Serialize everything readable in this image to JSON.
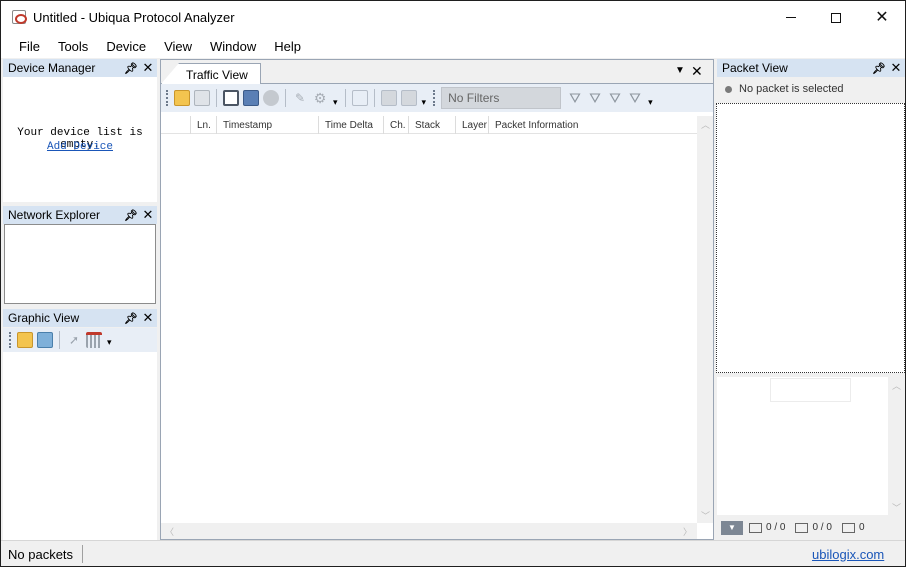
{
  "window": {
    "title": "Untitled - Ubiqua Protocol Analyzer"
  },
  "menu": {
    "items": [
      "File",
      "Tools",
      "Device",
      "View",
      "Window",
      "Help"
    ]
  },
  "device_manager": {
    "title": "Device Manager",
    "empty_message": "Your device list is empty.",
    "add_link": "Add Device"
  },
  "network_explorer": {
    "title": "Network Explorer"
  },
  "graphic_view": {
    "title": "Graphic View"
  },
  "traffic_view": {
    "tab_label": "Traffic View",
    "filter_text": "No Filters",
    "columns": [
      "Ln.",
      "Timestamp",
      "Time Delta",
      "Ch.",
      "Stack",
      "Layer",
      "Packet Information"
    ]
  },
  "packet_view": {
    "title": "Packet View",
    "status": "No packet is selected",
    "counter_1": "0 / 0",
    "counter_2": "0 / 0",
    "counter_3": "0"
  },
  "status_bar": {
    "text": "No packets",
    "link": "ubilogix.com"
  },
  "colors": {
    "panel_header": "#d6e3f2",
    "toolbar": "#e8eef6",
    "link": "#1a56b8"
  }
}
